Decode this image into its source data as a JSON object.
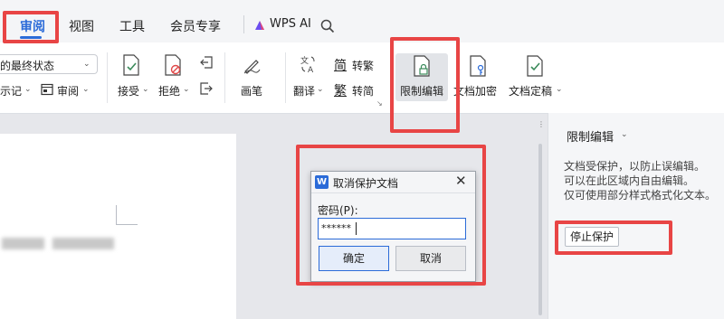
{
  "menu": {
    "tabs": [
      "审阅",
      "视图",
      "工具",
      "会员专享"
    ],
    "wps_ai": "WPS AI"
  },
  "ribbon": {
    "display_select": "的最终状态",
    "markup_label": "示记",
    "review_label": "审阅",
    "accept_label": "接受",
    "reject_label": "拒绝",
    "pen_label": "画笔",
    "translate_label": "翻译",
    "to_traditional_label": "转繁",
    "to_simplified_label": "转简",
    "restrict_edit_label": "限制编辑",
    "encrypt_label": "文档加密",
    "finalize_label": "文档定稿",
    "icon_trad_char": "简",
    "icon_simp_char": "繁"
  },
  "panel": {
    "title": "限制编辑",
    "desc_lines": [
      "文档受保护，以防止误编辑。",
      "可以在此区域内自由编辑。",
      "仅可使用部分样式格式化文本。"
    ],
    "stop_button": "停止保护"
  },
  "dialog": {
    "title": "取消保护文档",
    "password_label": "密码(P):",
    "password_value": "******",
    "ok_label": "确定",
    "cancel_label": "取消",
    "app_icon": "W"
  },
  "colors": {
    "accent": "#2b6bd8",
    "highlight_red": "#e84545",
    "icon_green": "#3a8a5a"
  }
}
